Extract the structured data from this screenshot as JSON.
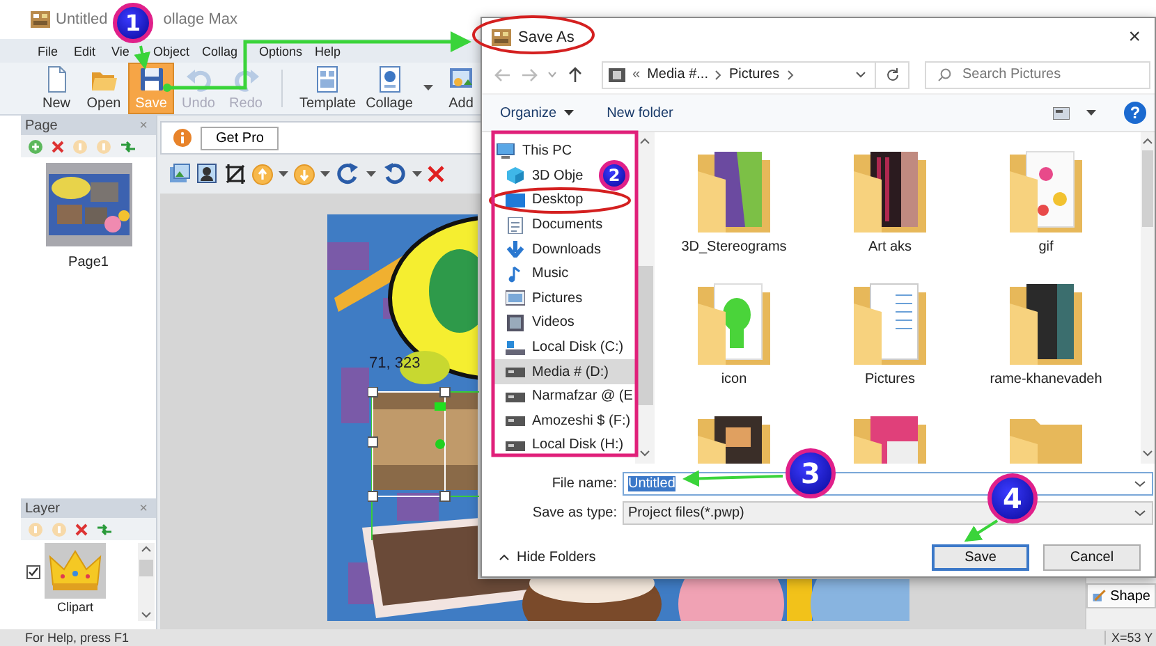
{
  "app": {
    "title": [
      "Untitled",
      "ollage Max"
    ],
    "menu": [
      "File",
      "Edit",
      "Vie",
      "Object",
      "Collag",
      "Options",
      "Help"
    ],
    "toolbar": [
      {
        "label": "New",
        "highlighted": false,
        "disabled": false,
        "dropdown": false
      },
      {
        "label": "Open",
        "highlighted": false,
        "disabled": false,
        "dropdown": false
      },
      {
        "label": "Save",
        "highlighted": true,
        "disabled": false,
        "dropdown": false
      },
      {
        "label": "Undo",
        "highlighted": false,
        "disabled": true,
        "dropdown": false
      },
      {
        "label": "Redo",
        "highlighted": false,
        "disabled": true,
        "dropdown": false
      },
      {
        "label": "Template",
        "highlighted": false,
        "disabled": false,
        "dropdown": false
      },
      {
        "label": "Collage",
        "highlighted": false,
        "disabled": false,
        "dropdown": true
      },
      {
        "label": "Add",
        "highlighted": false,
        "disabled": false,
        "dropdown": false
      }
    ],
    "page_panel": {
      "title": "Page",
      "close": "×",
      "pages": [
        {
          "label": "Page1"
        }
      ]
    },
    "layer_panel": {
      "title": "Layer",
      "close": "×",
      "layers": [
        {
          "label": "Clipart",
          "checked": true
        }
      ]
    },
    "get_pro": "Get Pro",
    "canvas_readout": "71, 323",
    "right_panel": {
      "button": "Shape"
    },
    "status_bar": {
      "help": "For Help, press F1",
      "coordinates": "X=53 Y"
    }
  },
  "dialog": {
    "title": "Save As",
    "close": "×",
    "address": {
      "prefix": "«",
      "parts": [
        "Media #...",
        "Pictures"
      ]
    },
    "search": {
      "placeholder": "Search Pictures"
    },
    "commands": [
      "Organize",
      "New folder"
    ],
    "help": "?",
    "nav": [
      {
        "label": "This PC",
        "selected": false,
        "children": [
          {
            "label": "3D Obje",
            "selected": false
          },
          {
            "label": "Desktop",
            "selected": false
          },
          {
            "label": "Documents",
            "selected": false
          },
          {
            "label": "Downloads",
            "selected": false
          },
          {
            "label": "Music",
            "selected": false
          },
          {
            "label": "Pictures",
            "selected": false
          },
          {
            "label": "Videos",
            "selected": false
          },
          {
            "label": "Local Disk (C:)",
            "selected": false
          },
          {
            "label": "Media # (D:)",
            "selected": true
          },
          {
            "label": "Narmafzar @ (E",
            "selected": false
          },
          {
            "label": "Amozeshi $ (F:)",
            "selected": false
          },
          {
            "label": "Local Disk (H:)",
            "selected": false
          }
        ]
      }
    ],
    "folders": [
      {
        "name": "3D_Stereograms"
      },
      {
        "name": "Art aks"
      },
      {
        "name": "gif"
      },
      {
        "name": "icon"
      },
      {
        "name": "Pictures"
      },
      {
        "name": "rame-khanevadeh"
      }
    ],
    "file_name": {
      "label": "File name:",
      "value": "Untitled",
      "text_selected": true
    },
    "save_type": {
      "label": "Save as type:",
      "value": "Project files(*.pwp)"
    },
    "hide_folders": "Hide Folders",
    "buttons": [
      {
        "label": "Save",
        "default": true
      },
      {
        "label": "Cancel",
        "default": false
      }
    ]
  },
  "annotations": [
    {
      "label": "1"
    },
    {
      "label": "2"
    },
    {
      "label": "3"
    },
    {
      "label": "4"
    }
  ]
}
